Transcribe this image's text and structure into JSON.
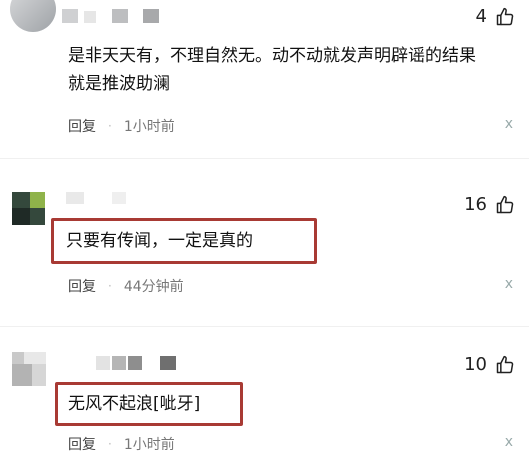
{
  "comments": [
    {
      "likes": "4",
      "text_line1": "是非天天有，不理自然无。动不动就发声明辟谣的结果",
      "text_line2": "就是推波助澜",
      "reply_label": "回复",
      "time": "1小时前",
      "more_icon": "ⅹ"
    },
    {
      "likes": "16",
      "text": "只要有传闻，一定是真的",
      "reply_label": "回复",
      "time": "44分钟前",
      "more_icon": "ⅹ"
    },
    {
      "likes": "10",
      "text": "无风不起浪[呲牙]",
      "reply_label": "回复",
      "time": "1小时前",
      "more_icon": "ⅹ"
    }
  ],
  "colors": {
    "highlight": "#a83a34"
  }
}
